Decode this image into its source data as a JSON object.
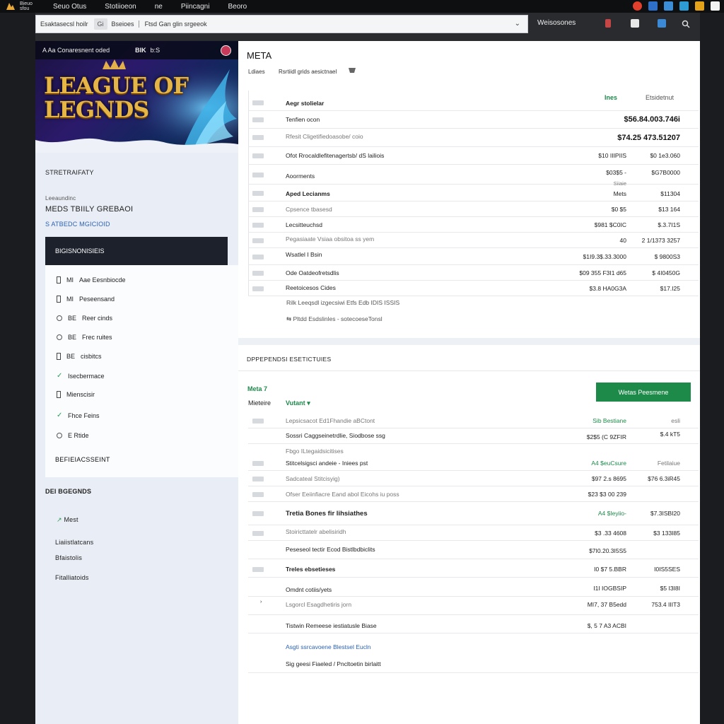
{
  "os": {
    "app_name": "Bieuo sfou",
    "menu": [
      "Seuo Otus",
      "Stotiioeon",
      "ne",
      "Piincagni",
      "Beoro"
    ]
  },
  "address": {
    "seg1": "Esaktasecsl hoilr",
    "seg2": "Gi",
    "seg3": "Bseioes",
    "seg4": "Ftsd Gan glin srgeeok",
    "right_label": "Weisosones"
  },
  "banner": {
    "top_left": "A Aa Conaresnent oded",
    "top_mid": "BIK",
    "top_mid2": "b:S",
    "title_line1": "LEAGUE OF",
    "title_line2": "LEGNDS"
  },
  "left": {
    "section1": "STRETRAIFATY",
    "sub_small": "Leeaundinc",
    "sub_big": "MEDS TBIILY GREBAOI",
    "sub_blue": "S ATBEDC MGICIOID",
    "panel_title": "BIGISNONISIEIS",
    "list": [
      {
        "kind": "box",
        "mark": "MI",
        "label": "Aae Eesnbiocde"
      },
      {
        "kind": "box",
        "mark": "MI",
        "label": "Peseensand"
      },
      {
        "kind": "radio",
        "mark": "BE",
        "label": "Reer cinds"
      },
      {
        "kind": "radio",
        "mark": "BE",
        "label": "Frec ruites"
      },
      {
        "kind": "box",
        "mark": "BE",
        "label": "cisbitcs"
      },
      {
        "kind": "check",
        "mark": "",
        "label": "Isecbermace"
      },
      {
        "kind": "box",
        "mark": "",
        "label": "Mienscisir"
      },
      {
        "kind": "check",
        "mark": "",
        "label": "Fhce Feins"
      },
      {
        "kind": "radio",
        "mark": "",
        "label": "E Rtide"
      }
    ],
    "list_footer": "BEFIEIACSSEINT",
    "section2": "DEI BGEGNDS",
    "links": [
      "Mest",
      "Liaiistlatcans",
      "Bfaistolis",
      "Fitalliatoids"
    ]
  },
  "card1": {
    "title": "META",
    "sub1": "Ldiaes",
    "sub2": "Rsrtiidl grids aesictnael",
    "col1": "Ines",
    "col2": "Etsidetnut",
    "rows": [
      {
        "label": "Aegr stolielar",
        "v1": "",
        "v2": "",
        "style": "bold"
      },
      {
        "label": "Tenfien ocon",
        "v1": "",
        "v2": "$56.84.003.746i",
        "style": "big"
      },
      {
        "label": "Rfesit Cligetifiedoasobe/ coio",
        "v1": "",
        "v2": "$74.25 473.51207",
        "style": "big"
      },
      {
        "label": "Ofot Rrocaldlefitenagertsb/ dS lailiois",
        "v1": "$10 IIIPIIS",
        "v2": "$0 1e3.060",
        "style": ""
      },
      {
        "label": "Aoorments",
        "v1": "$03$5 -",
        "v2": "$G7B0000",
        "style": "bold"
      },
      {
        "label": "Aped Lecianms",
        "v1": "Mets",
        "v2": "$11304",
        "style": "bold"
      },
      {
        "label": "Cpsence tbasesd",
        "v1": "$0 $5",
        "v2": "$13 164",
        "style": ""
      },
      {
        "label": "Lecsitteuchsd",
        "v1": "$981 $C0IC",
        "v2": "$.3.7I1S",
        "style": ""
      },
      {
        "label": "Pegasiaate Vsiaa obsitoa ss yem",
        "v1": "40",
        "v2": "2 1/1373 3257",
        "style": ""
      },
      {
        "label": "Wsatlel I Bsin",
        "v1": "$1I9.3$.33.3000",
        "v2": "$ 9800S3",
        "style": ""
      },
      {
        "label": "Ode Oatdeofretsdlis",
        "v1": "$09 355 F3I1 d65",
        "v2": "$ 4I0450G",
        "style": ""
      },
      {
        "label": "Reetoicesos Cides",
        "v1": "$3.8 HA0G3A",
        "v2": "$17.I25",
        "style": ""
      }
    ],
    "small_note": "Siiaie",
    "foot1": "Rilk Leeqsdl izgecsiwi Etfs Edb IDIS ISSIS",
    "foot2": "Pltdd Esdslinles - sotecoeseTonsl"
  },
  "card2": {
    "title": "DPPEPENDSI ESETICTUIES",
    "meta_tag": "Meta 7",
    "meta_label": "Mieteire",
    "meta_value": "Vutant",
    "button": "Wetas Peesmene",
    "rows": [
      {
        "label": "Lepsicsacot Ed1Fhandie aBCtont",
        "v1": "Sib Bestiane",
        "v2": "esli"
      },
      {
        "label": "Sossri Caggseinetrdlie, Siodbose ssg",
        "v1": "$2$5 (C 9ZFIR",
        "v2": "$.4 kT5"
      },
      {
        "label": "Fbgo ILtegaidsicitises",
        "v1": "",
        "v2": ""
      },
      {
        "label": "Stitcelsigsci andeie - Iniees pst",
        "v1": "A4 $euCsure",
        "v2": "Fetilaiue"
      },
      {
        "label": "Sadcateal Stitcisyig)",
        "v1": "$97 2.s 8695",
        "v2": "$76 6.3iR45"
      },
      {
        "label": "Ofser Eeiinfiacre Eand abol Eicohs iu poss",
        "v1": "$23 $3 00 239",
        "v2": ""
      },
      {
        "label": "Tretia Bones fir lihsiathes",
        "v1": "A4 $Ieyiio-",
        "v2": "$7.3ISBI20"
      },
      {
        "label": "Stoiricttatelr abelisiridh",
        "v1": "$3 .33 4608",
        "v2": "$3 133I85"
      },
      {
        "label": "Peseseol tectir Ecod Bistlbdbiclits",
        "v1": "$7I0.20.3I5S5",
        "v2": ""
      },
      {
        "label": "Treles ebsetieses",
        "v1": "I0 $7 5.BBR",
        "v2": "I0IS5SES"
      },
      {
        "label": "Omdnt cotiis/yets",
        "v1": "I1I IOGBSIP",
        "v2": "$5 I3I8I"
      },
      {
        "label": "Lsgorcl Esagdhetiris jorn",
        "v1": "MI7, 37 B5edd",
        "v2": "753.4 IIIT3"
      },
      {
        "label": "Tistwin Remeese iestiatusle Biase",
        "v1": "$, 5 7 A3 ACBI",
        "v2": ""
      },
      {
        "label": "Asgti ssrcavoene Blestsel Eucln",
        "v1": "",
        "v2": ""
      },
      {
        "label": "Sig geesi Fiaeled / Pncltoetin birlaitt",
        "v1": "",
        "v2": ""
      }
    ]
  }
}
